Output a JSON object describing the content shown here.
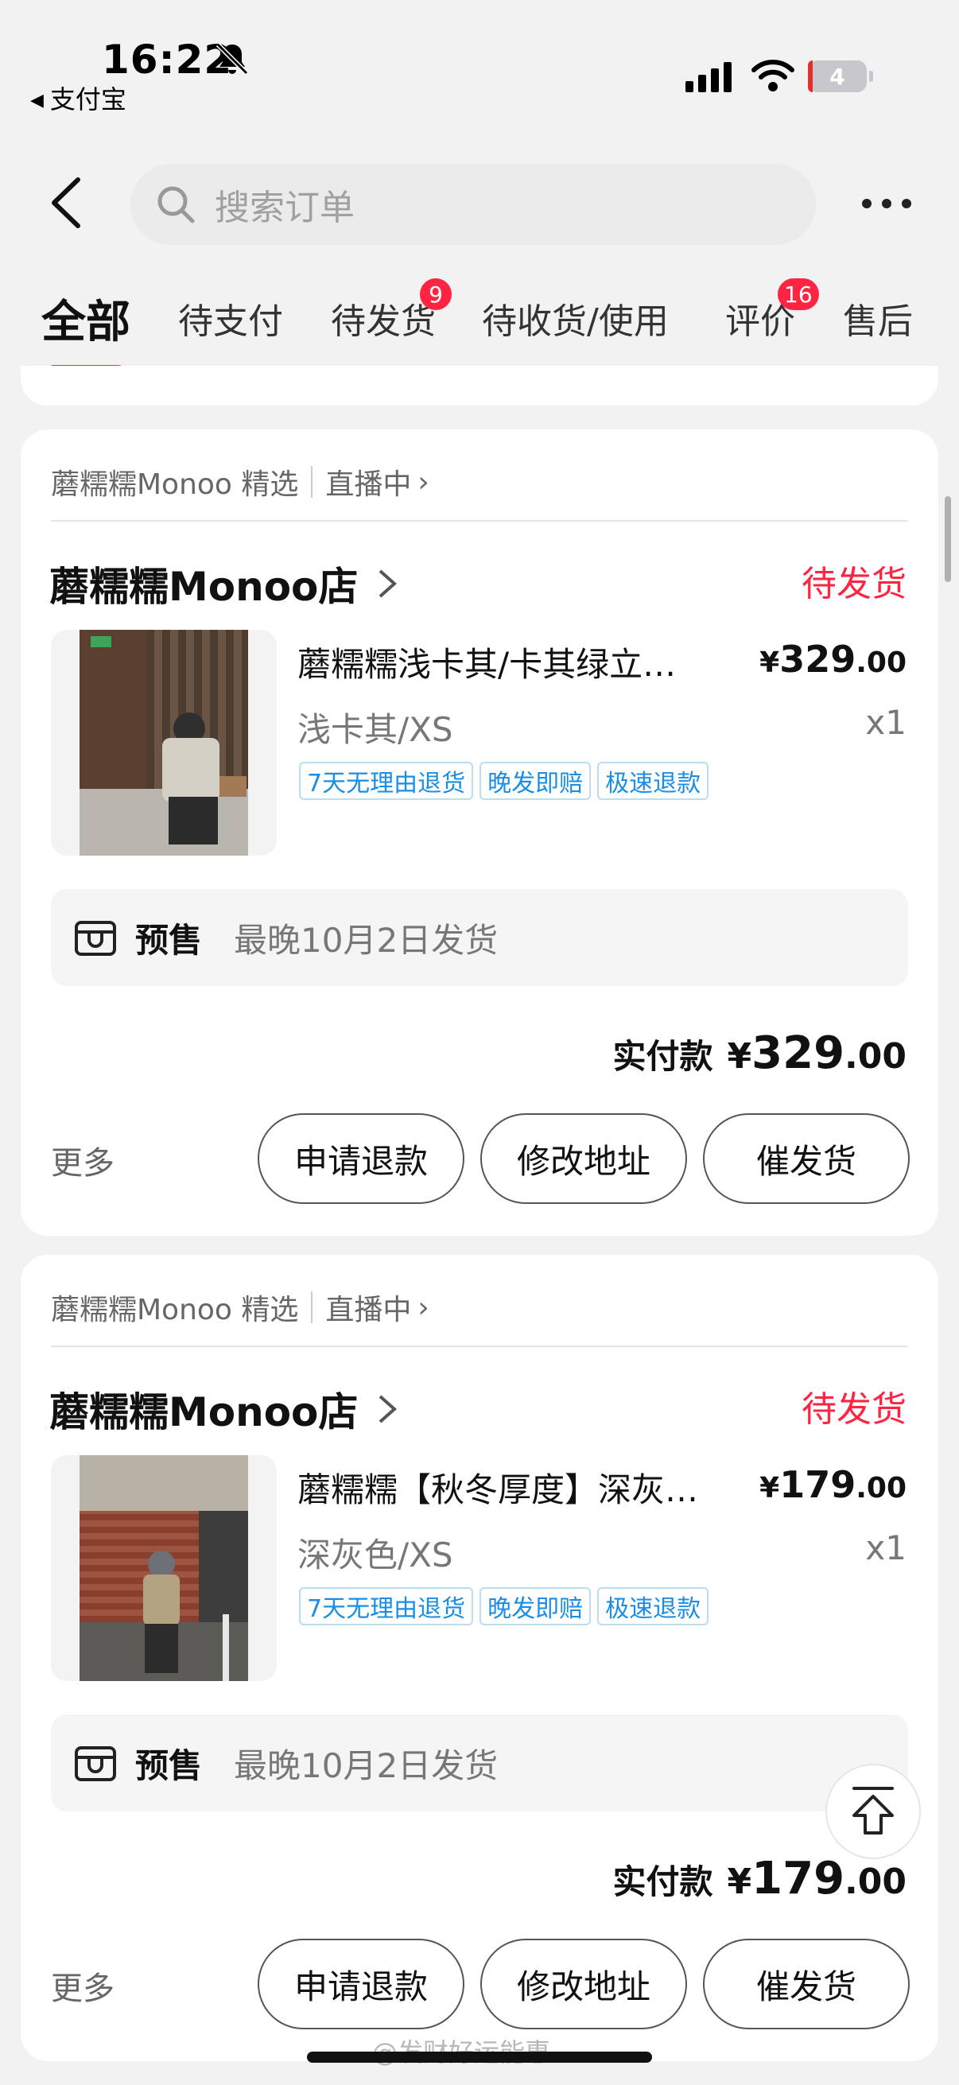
{
  "status_bar": {
    "time": "16:22",
    "back_app": "支付宝",
    "battery": "4"
  },
  "search": {
    "placeholder": "搜索订单"
  },
  "tabs": [
    {
      "label": "全部"
    },
    {
      "label": "待支付"
    },
    {
      "label": "待发货",
      "badge": "9"
    },
    {
      "label": "待收货/使用"
    },
    {
      "label": "评价",
      "badge": "16"
    },
    {
      "label": "售后"
    }
  ],
  "orders": [
    {
      "source": "蘑糯糯Monoo 精选",
      "live": "直播中",
      "shop": "蘑糯糯Monoo店",
      "status": "待发货",
      "title": "蘑糯糯浅卡其/卡其绿立…",
      "price_yen": "¥",
      "price_int": "329",
      "price_dec": ".00",
      "sku": "浅卡其/XS",
      "qty": "x1",
      "tags": [
        "7天无理由退货",
        "晚发即赔",
        "极速退款"
      ],
      "presale_label": "预售",
      "presale_text": "最晚10月2日发货",
      "paid_label": "实付款",
      "paid_yen": "¥",
      "paid_int": "329",
      "paid_dec": ".00",
      "more": "更多",
      "buttons": [
        "申请退款",
        "修改地址",
        "催发货"
      ]
    },
    {
      "source": "蘑糯糯Monoo 精选",
      "live": "直播中",
      "shop": "蘑糯糯Monoo店",
      "status": "待发货",
      "title": "蘑糯糯【秋冬厚度】深灰…",
      "price_yen": "¥",
      "price_int": "179",
      "price_dec": ".00",
      "sku": "深灰色/XS",
      "qty": "x1",
      "tags": [
        "7天无理由退货",
        "晚发即赔",
        "极速退款"
      ],
      "presale_label": "预售",
      "presale_text": "最晚10月2日发货",
      "paid_label": "实付款",
      "paid_yen": "¥",
      "paid_int": "179",
      "paid_dec": ".00",
      "more": "更多",
      "buttons": [
        "申请退款",
        "修改地址",
        "催发货"
      ]
    }
  ],
  "watermark": "@发财好运能惠",
  "icons": {
    "bell": "bell-slash-icon",
    "back": "chevron-left-icon",
    "search": "search-icon",
    "more": "ellipsis-icon",
    "presale": "box-icon",
    "top": "back-to-top-icon"
  },
  "colors": {
    "accent": "#ff2442",
    "tag_blue": "#1a8ee6"
  }
}
